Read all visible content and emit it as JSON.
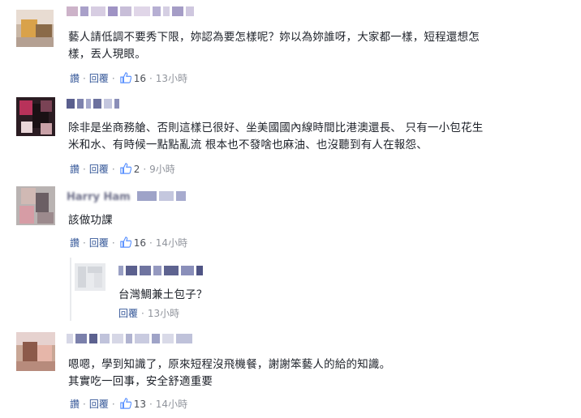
{
  "colors": {
    "link": "#365899",
    "meta": "#90949c",
    "text": "#1d2129",
    "like": "#5890ff"
  },
  "labels": {
    "like": "讚",
    "reply": "回覆",
    "separator": "·"
  },
  "comments": [
    {
      "name_obscured": "",
      "lines": [
        "藝人請低調不要秀下限，妳認為要怎樣呢？妳以為妳誰呀，大家都一樣，短程還想怎",
        "樣，丟人現眼。"
      ],
      "likes": "16",
      "time": "13小時"
    },
    {
      "name_obscured": "",
      "lines": [
        "除非是坐商務艙、否則這樣已很好、坐美國國內線時間比港澳還長、 只有一小包花生",
        "米和水、有時候一點點亂流 根本也不發啥也麻油、也沒聽到有人在報怨、"
      ],
      "likes": "2",
      "time": "9小時"
    },
    {
      "name_obscured": "Harry Ham",
      "lines": [
        "該做功課"
      ],
      "likes": "16",
      "time": "14小時"
    },
    {
      "name_obscured": "",
      "lines": [
        "台灣鯛兼土包子？"
      ],
      "likes": "",
      "time": "13小時"
    },
    {
      "name_obscured": "",
      "lines": [
        "嗯嗯，學到知識了，原來短程沒飛機餐，謝謝笨藝人的給的知識。",
        "其實吃一回事，安全舒適重要"
      ],
      "likes": "13",
      "time": "14小時"
    }
  ]
}
